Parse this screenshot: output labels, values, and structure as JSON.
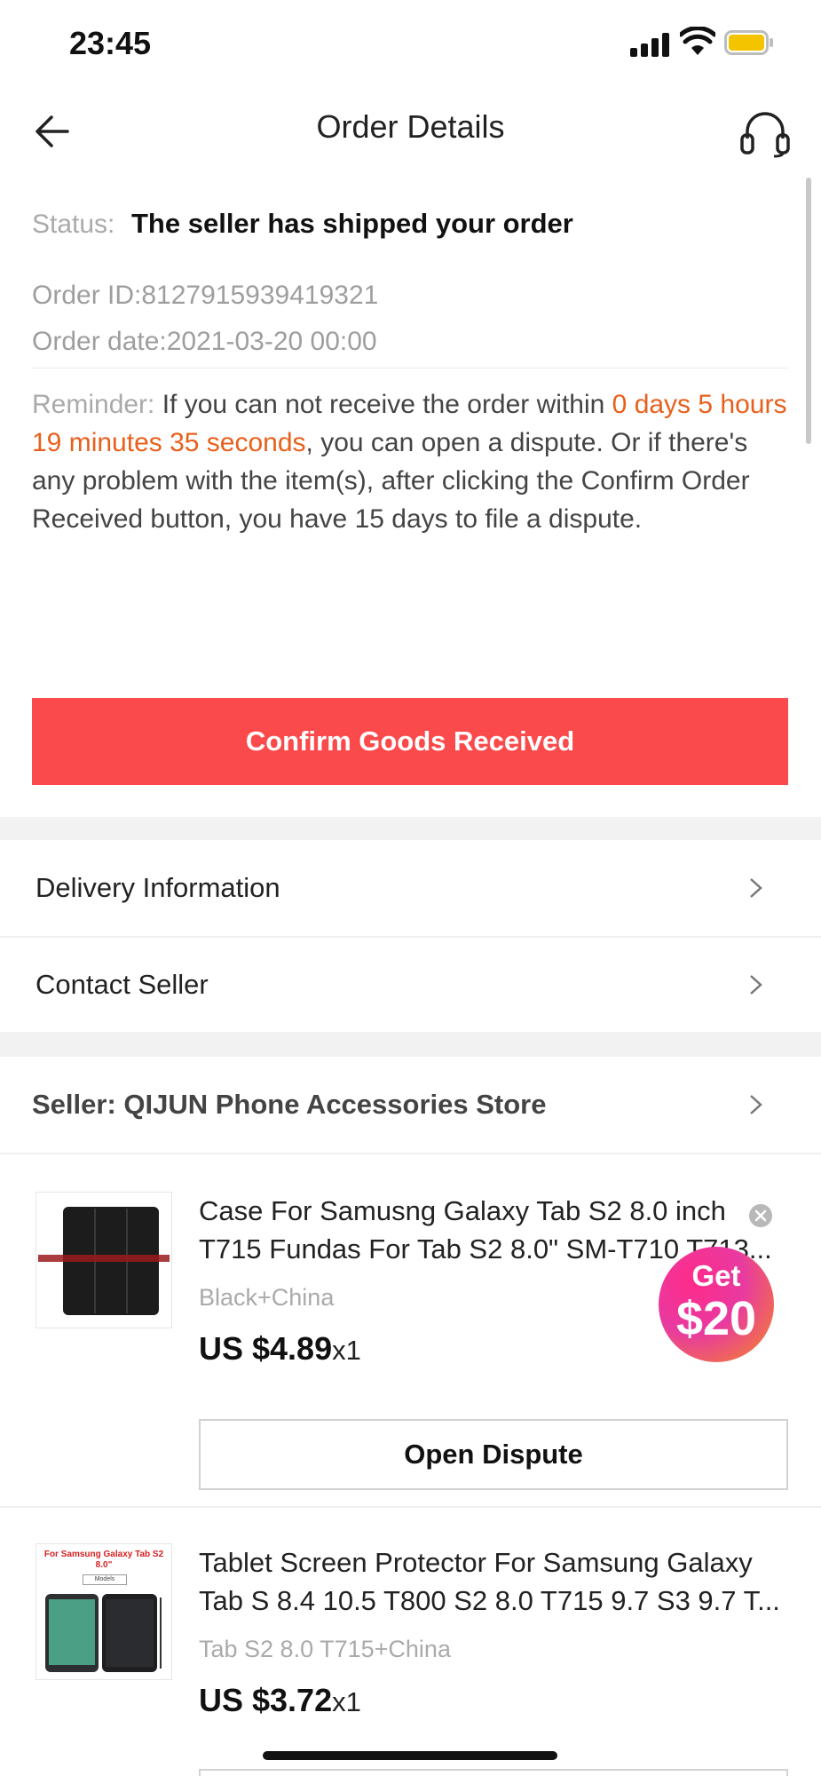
{
  "status_bar": {
    "time": "23:45"
  },
  "nav": {
    "title": "Order Details"
  },
  "order": {
    "status_label": "Status:",
    "status_value": "The seller has shipped your order",
    "order_id": "Order ID:8127915939419321",
    "order_date": "Order date:2021-03-20 00:00",
    "reminder_label": "Reminder:",
    "reminder_text_1": " If you can not receive the order within ",
    "reminder_countdown": "0 days 5 hours 19 minutes 35 seconds",
    "reminder_text_2": ", you can open a dispute. Or if there's any problem with the item(s), after clicking the Confirm Order Received button, you have 15 days to file a dispute."
  },
  "confirm_button": "Confirm Goods Received",
  "menu": {
    "delivery": "Delivery Information",
    "contact": "Contact Seller"
  },
  "seller": {
    "label": "Seller: QIJUN Phone Accessories Store"
  },
  "products": [
    {
      "title": "Case For Samusng Galaxy Tab S2 8.0 inch T715 Fundas For Tab S2 8.0\" SM-T710 T713...",
      "variant": "Black+China",
      "price": "US $4.89",
      "qty": "x1"
    },
    {
      "title": "Tablet Screen Protector For Samsung Galaxy Tab S 8.4 10.5 T800 S2 8.0 T715 9.7 S3 9.7 T...",
      "variant": "Tab S2 8.0 T715+China",
      "price": "US $3.72",
      "qty": "x1",
      "thumb_caption": "For Samsung Galaxy Tab S2 8.0\"",
      "thumb_models": "Models"
    }
  ],
  "dispute_button": "Open Dispute",
  "promo": {
    "get": "Get",
    "amount": "$20"
  },
  "colors": {
    "accent_red": "#fb4a4b",
    "countdown_orange": "#e8601c",
    "promo_pink": "#e83aa0"
  }
}
